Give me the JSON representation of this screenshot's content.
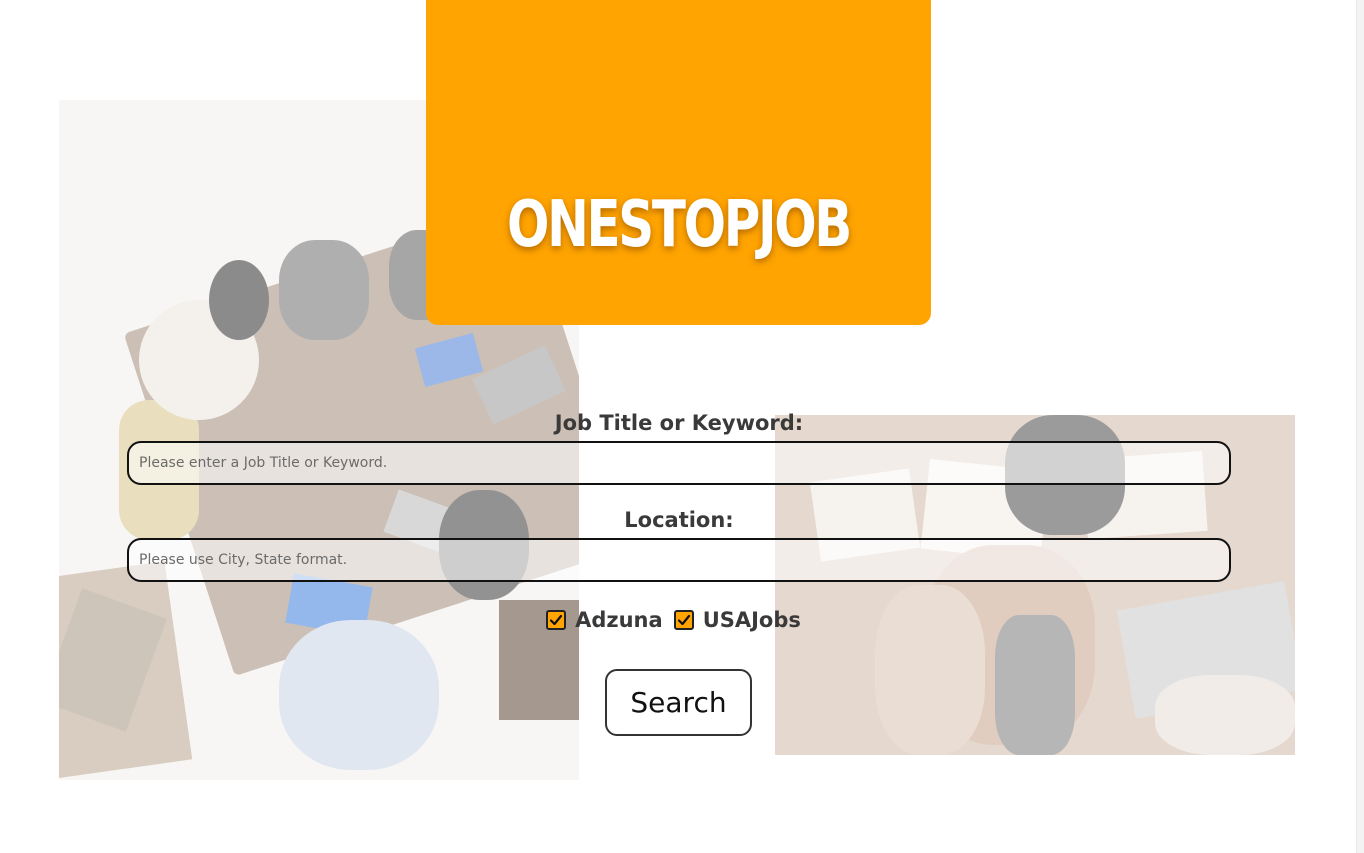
{
  "brand": {
    "logo_text": "ONESTOPJOB",
    "accent_color": "#ffa400"
  },
  "search_form": {
    "keyword": {
      "label": "Job Title or Keyword:",
      "placeholder": "Please enter a Job Title or Keyword.",
      "value": ""
    },
    "location": {
      "label": "Location:",
      "placeholder": "Please use City, State format.",
      "value": ""
    },
    "sources": [
      {
        "label": "Adzuna",
        "checked": true
      },
      {
        "label": "USAJobs",
        "checked": true
      }
    ],
    "submit_label": "Search"
  },
  "background_images": [
    {
      "name": "team-meeting-photo"
    },
    {
      "name": "team-hands-photo"
    }
  ]
}
